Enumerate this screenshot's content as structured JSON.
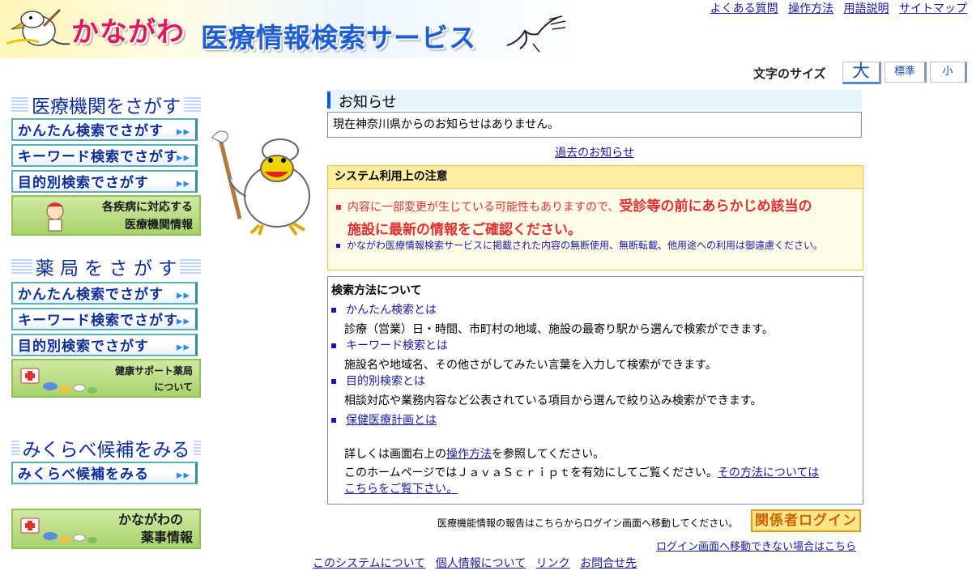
{
  "header": {
    "logo_kanagawa": "かながわ",
    "logo_service": "医療情報検索サービス",
    "top_links": [
      "よくある質問",
      "操作方法",
      "用語説明",
      "サイトマップ"
    ]
  },
  "font_size": {
    "label": "文字のサイズ",
    "large": "大",
    "normal": "標準",
    "small": "小"
  },
  "nav": {
    "medical": {
      "title": "医療機関をさがす",
      "easy": "かんたん検索でさがす",
      "keyword": "キーワード検索でさがす",
      "purpose": "目的別検索でさがす",
      "disease_line1": "各疾病に対応する",
      "disease_line2": "医療機関情報"
    },
    "pharmacy": {
      "title": "薬 局 を さ が す",
      "easy": "かんたん検索でさがす",
      "keyword": "キーワード検索でさがす",
      "purpose": "目的別検索でさがす",
      "support_line1": "健康サポート薬局",
      "support_line2": "について"
    },
    "compare": {
      "title": "みくらべ候補をみる",
      "button": "みくらべ候補をみる"
    },
    "pharma_info_line1": "かながわの",
    "pharma_info_line2": "薬事情報",
    "arrow": "▸▸"
  },
  "notice": {
    "title": "お知らせ",
    "body": "現在神奈川県からのお知らせはありません。",
    "past_link": "過去のお知らせ"
  },
  "caution": {
    "title": "システム利用上の注意",
    "item1_plain": "内容に一部変更が生じている可能性もありますので、",
    "item1_bold_a": "受診等の前にあらかじめ該当の",
    "item1_bold_b": "施設に最新の情報をご確認ください。",
    "item2": "かながわ医療情報検索サービスに掲載された内容の無断使用、無断転載、他用途への利用は御遠慮ください。"
  },
  "howto": {
    "title": "検索方法について",
    "items": [
      {
        "label": "かんたん検索とは",
        "desc": "診療（営業）日・時間、市町村の地域、施設の最寄り駅から選んで検索ができます。"
      },
      {
        "label": "キーワード検索とは",
        "desc": "施設名や地域名、その他さがしてみたい言葉を入力して検索ができます。"
      },
      {
        "label": "目的別検索とは",
        "desc": "相談対応や業務内容など公表されている項目から選んで絞り込み検索ができます。"
      },
      {
        "label": "保健医療計画とは",
        "desc": ""
      }
    ],
    "detail_pre": "詳しくは画面右上の",
    "detail_link": "操作方法",
    "detail_post": "を参照してください。",
    "js_pre": "このホームページではＪａｖａＳｃｒｉｐｔを有効にしてご覧ください。",
    "js_link1": "その方法については",
    "js_link2": "こちらをご覧下さい。"
  },
  "login": {
    "note": "医療機能情報の報告はこちらからログイン画面へ移動してください。",
    "button": "関係者ログイン",
    "help": "ログイン画面へ移動できない場合はこちら"
  },
  "footer": {
    "links": [
      "このシステムについて",
      "個人情報について",
      "リンク",
      "お問合せ先"
    ]
  }
}
